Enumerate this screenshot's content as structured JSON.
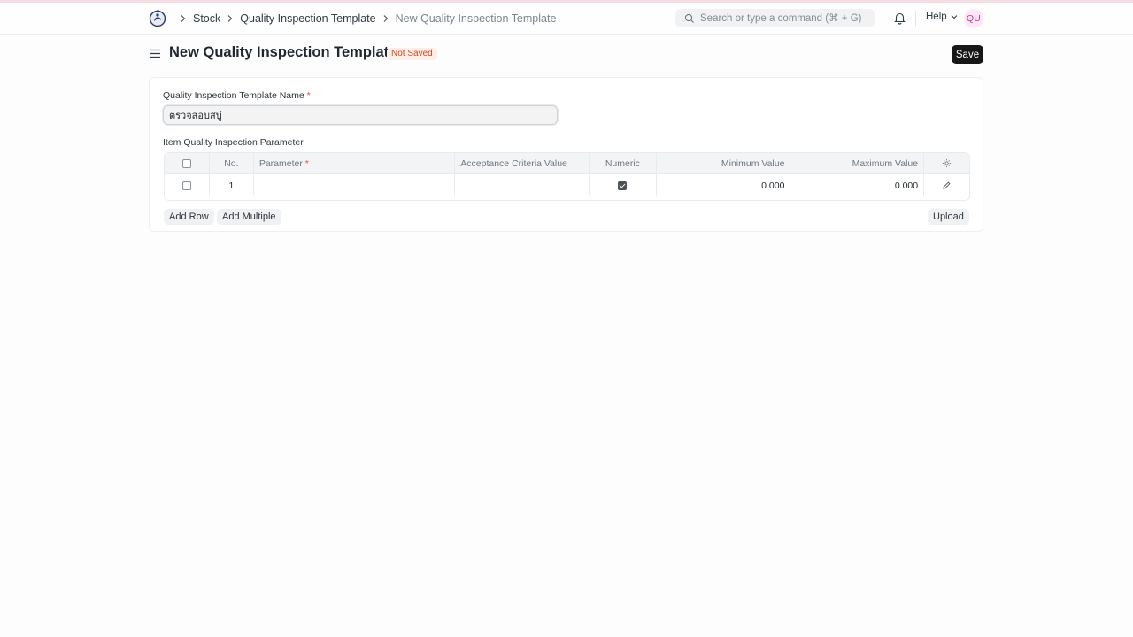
{
  "breadcrumbs": [
    "Stock",
    "Quality Inspection Template",
    "New Quality Inspection Template"
  ],
  "search": {
    "placeholder": "Search or type a command (⌘ + G)"
  },
  "help_label": "Help",
  "avatar_initials": "QU",
  "page": {
    "title": "New Quality Inspection Template",
    "status_badge": "Not Saved",
    "save_label": "Save"
  },
  "form": {
    "name_label": "Quality Inspection Template Name",
    "required_mark": "*",
    "name_value": "ตรวจสอบสบู่",
    "table_label": "Item Quality Inspection Parameter",
    "columns": {
      "no": "No.",
      "parameter": "Parameter",
      "acceptance": "Acceptance Criteria Value",
      "numeric": "Numeric",
      "min": "Minimum Value",
      "max": "Maximum Value"
    },
    "rows": [
      {
        "no": "1",
        "parameter": "",
        "acceptance": "",
        "numeric": true,
        "min": "0.000",
        "max": "0.000"
      }
    ],
    "add_row_label": "Add Row",
    "add_multiple_label": "Add Multiple",
    "upload_label": "Upload"
  },
  "colors": {
    "badge_bg": "#fdeee7",
    "badge_text": "#c24d2a",
    "primary_button": "#171717",
    "avatar_text": "#d3309b"
  },
  "icons": [
    "app-logo-icon",
    "chevron-right-icon",
    "search-icon",
    "bell-icon",
    "chevron-down-icon",
    "hamburger-menu-icon",
    "gear-icon",
    "pencil-icon"
  ]
}
